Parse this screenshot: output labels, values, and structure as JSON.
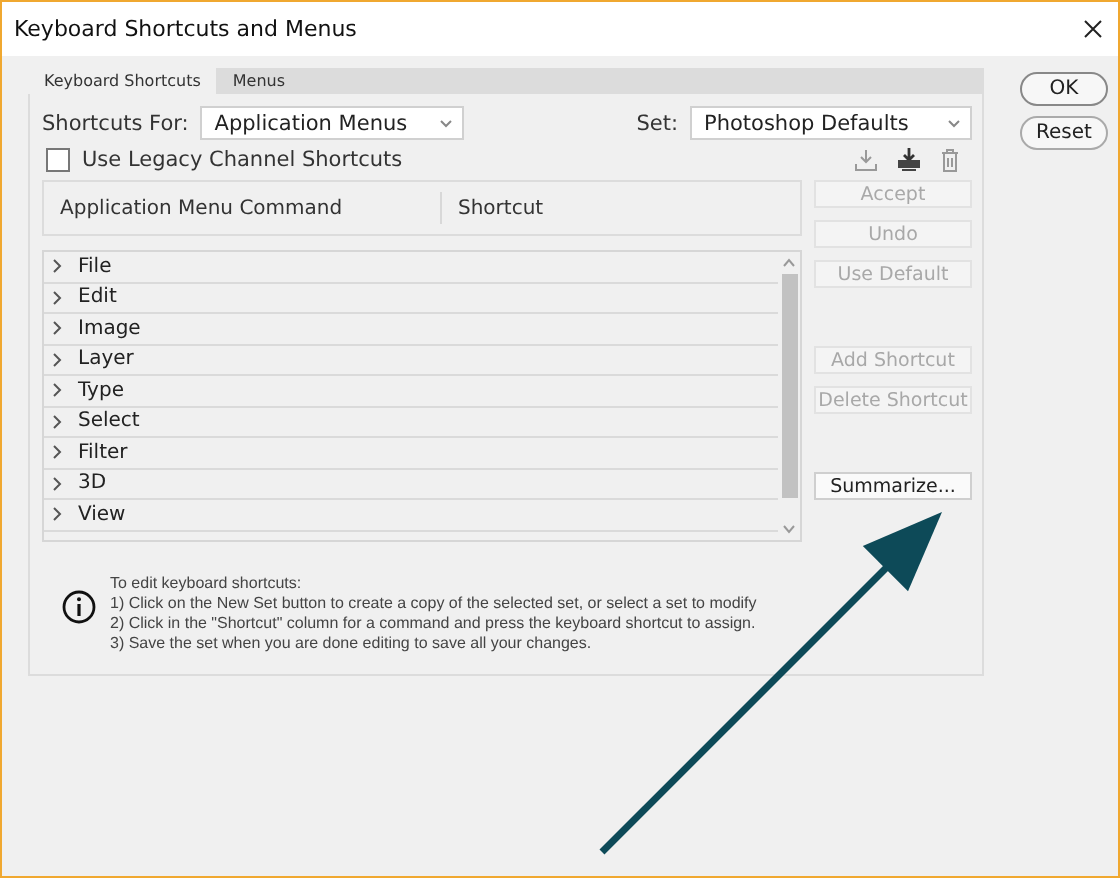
{
  "window": {
    "title": "Keyboard Shortcuts and Menus"
  },
  "tabs": [
    {
      "label": "Keyboard Shortcuts",
      "selected": true
    },
    {
      "label": "Menus",
      "selected": false
    }
  ],
  "shortcuts_for": {
    "label": "Shortcuts For:",
    "value": "Application Menus"
  },
  "set": {
    "label": "Set:",
    "value": "Photoshop Defaults"
  },
  "legacy_channel": {
    "label": "Use Legacy Channel Shortcuts",
    "checked": false
  },
  "table": {
    "columns": [
      "Application Menu Command",
      "Shortcut"
    ],
    "rows": [
      {
        "label": "File",
        "expanded": false
      },
      {
        "label": "Edit",
        "expanded": false
      },
      {
        "label": "Image",
        "expanded": false
      },
      {
        "label": "Layer",
        "expanded": false
      },
      {
        "label": "Type",
        "expanded": false
      },
      {
        "label": "Select",
        "expanded": false
      },
      {
        "label": "Filter",
        "expanded": false
      },
      {
        "label": "3D",
        "expanded": false
      },
      {
        "label": "View",
        "expanded": false
      }
    ]
  },
  "side_buttons": [
    {
      "label": "Accept",
      "disabled": true,
      "gap": false
    },
    {
      "label": "Undo",
      "disabled": true,
      "gap": false
    },
    {
      "label": "Use Default",
      "disabled": true,
      "gap": false
    },
    {
      "label": "Add Shortcut",
      "disabled": true,
      "gap": true
    },
    {
      "label": "Delete Shortcut",
      "disabled": true,
      "gap": false
    },
    {
      "label": "Summarize...",
      "disabled": false,
      "gap": true
    }
  ],
  "info": {
    "lines": [
      "To edit keyboard shortcuts:",
      "1) Click on the New Set button to create a copy of the selected set, or select a set to modify",
      "2) Click in the \"Shortcut\" column for a command and press the keyboard shortcut to assign.",
      "3) Save the set when you are done editing to save all your changes."
    ]
  },
  "dialog_buttons": [
    {
      "label": "OK",
      "default": true
    },
    {
      "label": "Reset",
      "default": false
    }
  ]
}
